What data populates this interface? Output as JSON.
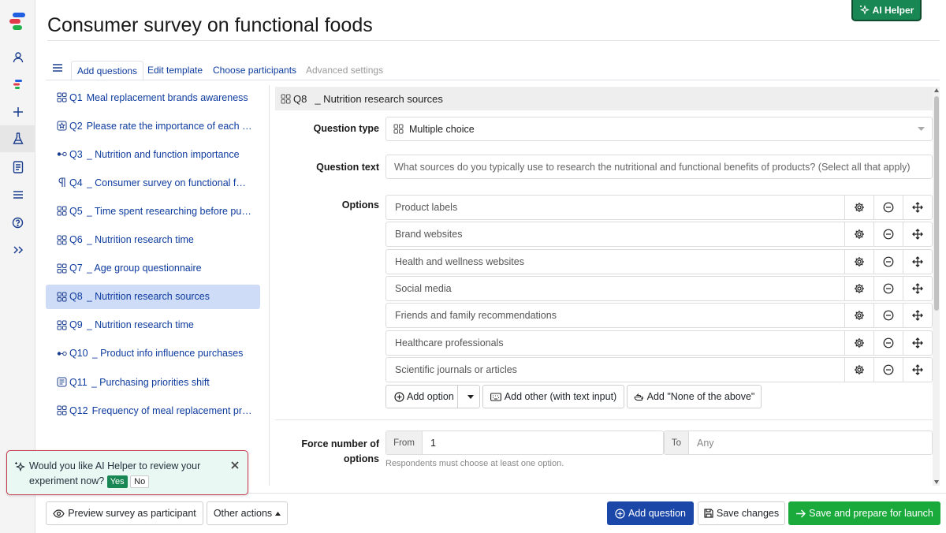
{
  "page_title": "Consumer survey on functional foods",
  "ai_helper_label": "AI Helper",
  "tabs": [
    {
      "label": "Add questions",
      "state": "active"
    },
    {
      "label": "Edit template",
      "state": "normal"
    },
    {
      "label": "Choose participants",
      "state": "normal"
    },
    {
      "label": "Advanced settings",
      "state": "disabled"
    }
  ],
  "questions": [
    {
      "num": "Q1",
      "text": "Meal replacement brands awareness",
      "icon": "grid-icon"
    },
    {
      "num": "Q2",
      "text": "Please rate the importance of each …",
      "icon": "star-rating-icon"
    },
    {
      "num": "Q3",
      "text": "_ Nutrition and function importance",
      "icon": "slider-icon"
    },
    {
      "num": "Q4",
      "text": "_ Consumer survey on functional f…",
      "icon": "paragraph-icon"
    },
    {
      "num": "Q5",
      "text": "_ Time spent researching before pu…",
      "icon": "grid-icon"
    },
    {
      "num": "Q6",
      "text": "_ Nutrition research time",
      "icon": "grid-icon"
    },
    {
      "num": "Q7",
      "text": "_ Age group questionnaire",
      "icon": "grid-icon"
    },
    {
      "num": "Q8",
      "text": "_ Nutrition research sources",
      "icon": "grid-icon"
    },
    {
      "num": "Q9",
      "text": "_ Nutrition research time",
      "icon": "grid-icon"
    },
    {
      "num": "Q10",
      "text": "_ Product info influence purchases",
      "icon": "slider-icon"
    },
    {
      "num": "Q11",
      "text": "_ Purchasing priorities shift",
      "icon": "text-doc-icon"
    },
    {
      "num": "Q12",
      "text": "Frequency of meal replacement pr…",
      "icon": "grid-icon"
    }
  ],
  "selected_question": "Q8",
  "editor": {
    "header_num": "Q8",
    "header_text": "_ Nutrition research sources",
    "question_type_label": "Question type",
    "question_type_value": "Multiple choice",
    "question_text_label": "Question text",
    "question_text_placeholder": "What sources do you typically use to research the nutritional and functional benefits of products? (Select all that apply)",
    "options_label": "Options",
    "options": [
      "Product labels",
      "Brand websites",
      "Health and wellness websites",
      "Social media",
      "Friends and family recommendations",
      "Healthcare professionals",
      "Scientific journals or articles"
    ],
    "add_option_label": "Add option",
    "add_other_label": "Add other (with text input)",
    "add_none_label": "Add \"None of the above\"",
    "force_label_line1": "Force number of",
    "force_label_line2": "options",
    "from_label": "From",
    "from_value": "1",
    "to_label": "To",
    "to_placeholder": "Any",
    "force_hint": "Respondents must choose at least one option."
  },
  "toast": {
    "message": "Would you like AI Helper to review your experiment now?",
    "yes_label": "Yes",
    "no_label": "No"
  },
  "footer": {
    "preview_label": "Preview survey as participant",
    "other_actions_label": "Other actions",
    "add_question_label": "Add question",
    "save_changes_label": "Save changes",
    "save_launch_label": "Save and prepare for launch"
  },
  "colors": {
    "link_blue": "#0d3b9e",
    "primary": "#1a47a8",
    "success": "#1aaa3c",
    "ai_green": "#198754",
    "selected_bg": "#cfdcf7",
    "toast_border": "#c9354b",
    "toast_bg": "#e9f8f3"
  }
}
